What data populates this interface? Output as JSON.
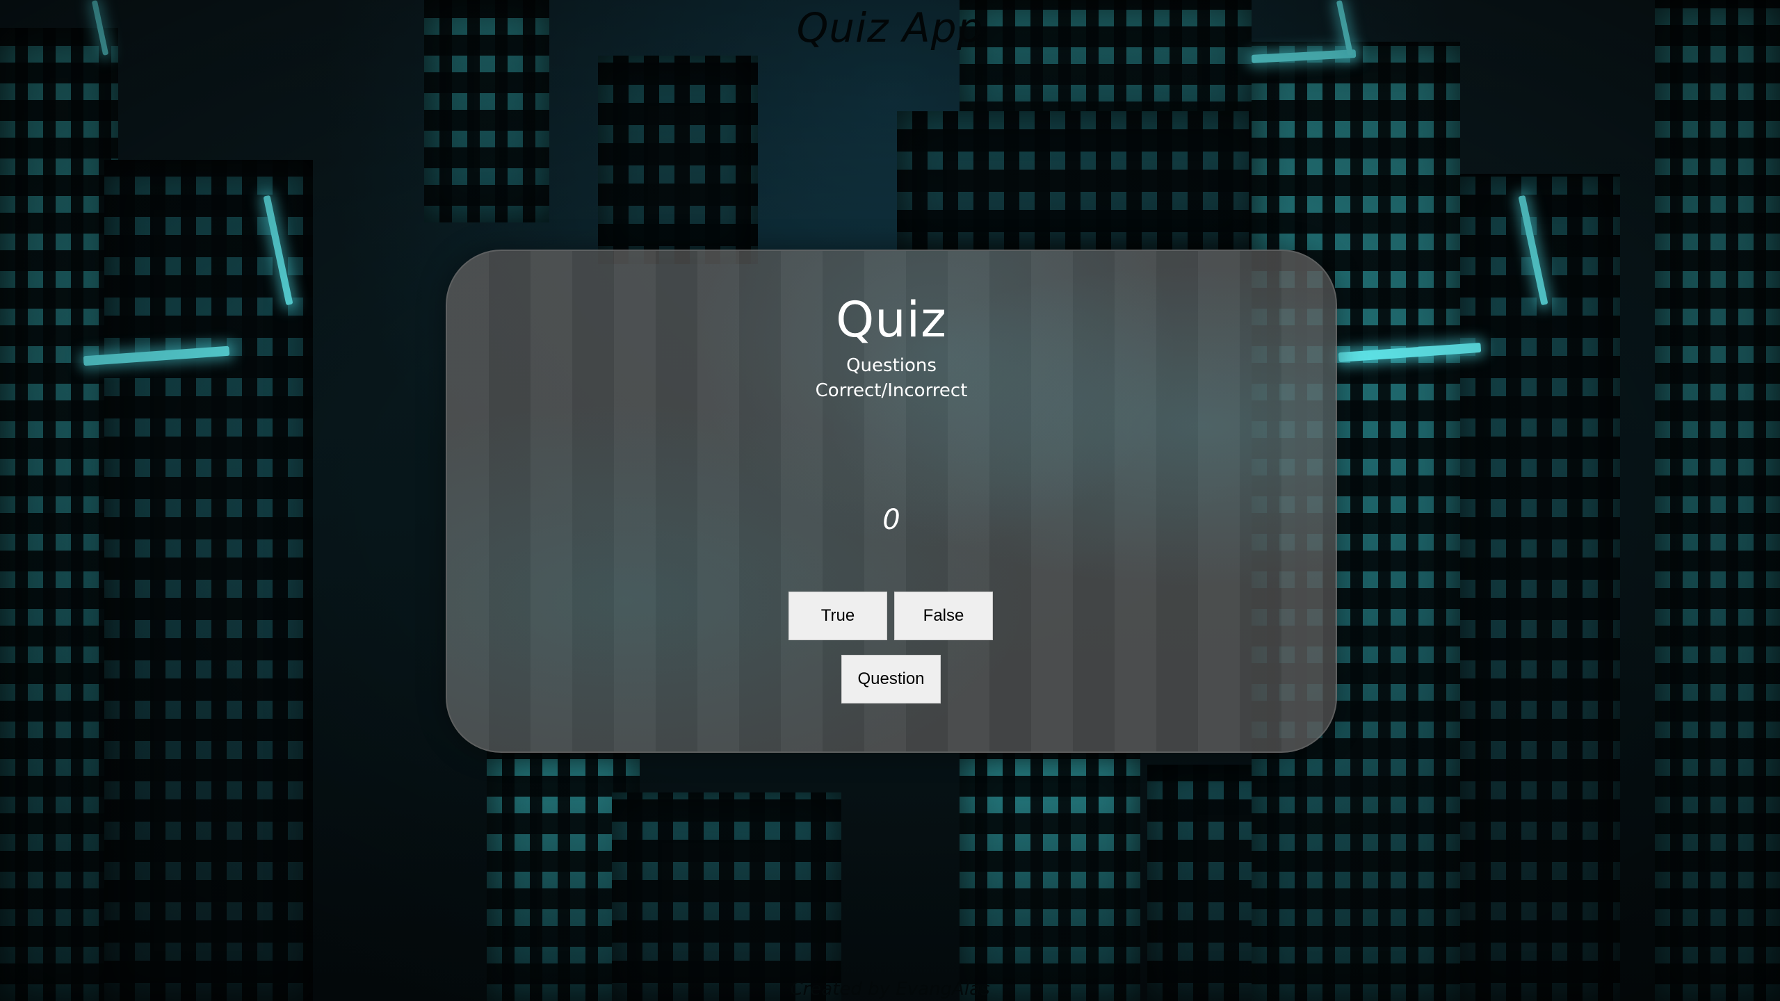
{
  "header": {
    "app_title": "Quiz App"
  },
  "quiz_card": {
    "heading": "Quiz",
    "questions_label": "Questions",
    "correct_incorrect_label": "Correct/Incorrect",
    "score": "0",
    "buttons": {
      "true_label": "True",
      "false_label": "False",
      "question_label": "Question"
    }
  },
  "footer": {
    "credit": "Created by EvangAlas"
  }
}
